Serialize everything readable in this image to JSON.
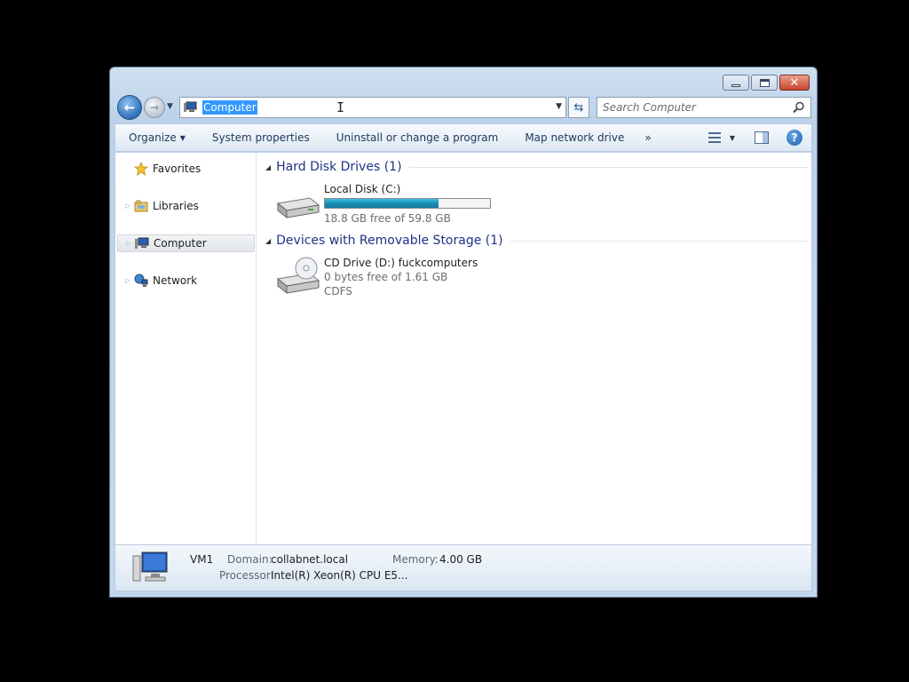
{
  "window": {
    "caption_buttons": [
      "minimize-icon",
      "maximize-icon",
      "close-icon"
    ]
  },
  "navbar": {
    "address": "Computer",
    "search_placeholder": "Search Computer"
  },
  "toolbar": {
    "organize": "Organize",
    "system_properties": "System properties",
    "uninstall": "Uninstall or change a program",
    "map_drive": "Map network drive",
    "more": "»"
  },
  "sidebar": {
    "items": [
      {
        "label": "Favorites",
        "icon": "star-icon"
      },
      {
        "label": "Libraries",
        "icon": "libraries-icon"
      },
      {
        "label": "Computer",
        "icon": "computer-icon",
        "selected": true
      },
      {
        "label": "Network",
        "icon": "network-icon"
      }
    ]
  },
  "content": {
    "groups": [
      {
        "title": "Hard Disk Drives (1)",
        "drives": [
          {
            "name": "Local Disk (C:)",
            "free": "18.8 GB free of 59.8 GB",
            "used_fraction": 0.686
          }
        ]
      },
      {
        "title": "Devices with Removable Storage (1)",
        "drives": [
          {
            "name": "CD Drive (D:) fuckcomputers",
            "free": "0 bytes free of 1.61 GB",
            "fs": "CDFS"
          }
        ]
      }
    ]
  },
  "details": {
    "name": "VM1",
    "domain_label": "Domain:",
    "domain": "collabnet.local",
    "memory_label": "Memory:",
    "memory": "4.00 GB",
    "processor_label": "Processor:",
    "processor": "Intel(R) Xeon(R) CPU E5..."
  },
  "colors": {
    "accent": "#3399ff",
    "group_title": "#1e3287",
    "bar_fill": "#1a8fb3"
  }
}
